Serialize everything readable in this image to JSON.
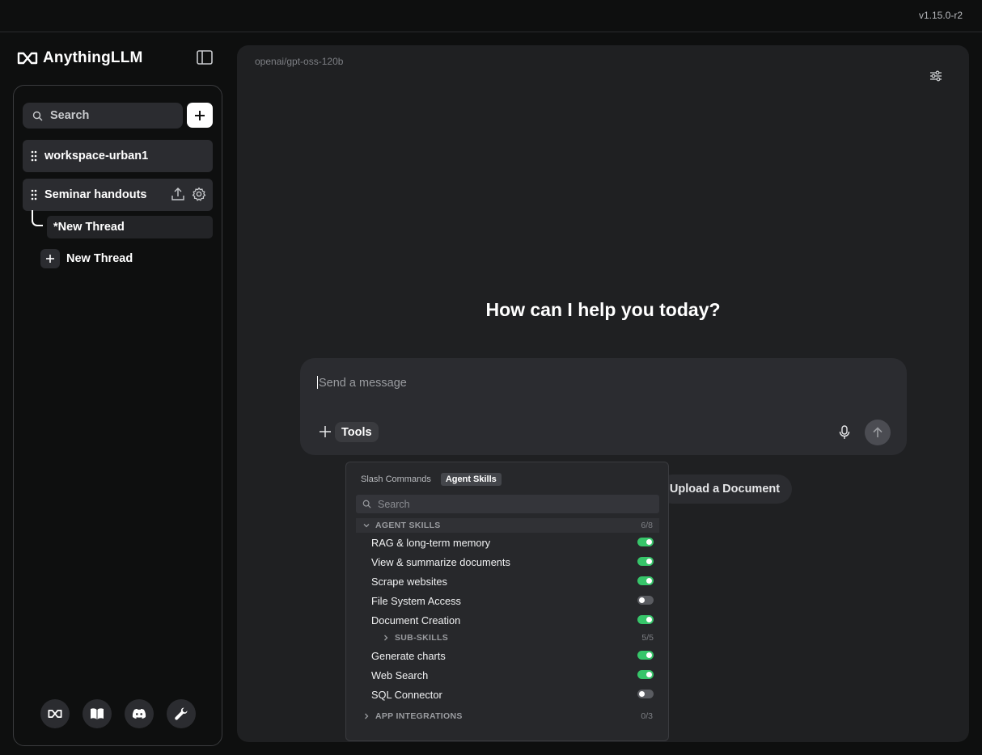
{
  "version": "v1.15.0-r2",
  "brand": {
    "name": "AnythingLLM"
  },
  "sidebar": {
    "search_placeholder": "Search",
    "workspaces": [
      {
        "label": "workspace-urban1"
      },
      {
        "label": "Seminar handouts"
      }
    ],
    "thread": {
      "label": "*New Thread"
    },
    "new_thread_label": "New Thread",
    "footer_icons": [
      "anythingllm-logo-icon",
      "book-icon",
      "discord-icon",
      "wrench-icon"
    ]
  },
  "main": {
    "model": "openai/gpt-oss-120b",
    "greeting": "How can I help you today?",
    "composer": {
      "placeholder": "Send a message",
      "tools_label": "Tools"
    },
    "upload_label": "Upload a Document"
  },
  "popup": {
    "tabs": [
      {
        "label": "Slash Commands",
        "active": false
      },
      {
        "label": "Agent Skills",
        "active": true
      }
    ],
    "search_placeholder": "Search",
    "agent_skills": {
      "title": "AGENT SKILLS",
      "count": "6/8",
      "items": [
        {
          "label": "RAG & long-term memory",
          "enabled": true
        },
        {
          "label": "View & summarize documents",
          "enabled": true
        },
        {
          "label": "Scrape websites",
          "enabled": true
        },
        {
          "label": "File System Access",
          "enabled": false
        },
        {
          "label": "Document Creation",
          "enabled": true
        }
      ],
      "sub_skills": {
        "title": "SUB-SKILLS",
        "count": "5/5"
      },
      "items_after": [
        {
          "label": "Generate charts",
          "enabled": true
        },
        {
          "label": "Web Search",
          "enabled": true
        },
        {
          "label": "SQL Connector",
          "enabled": false
        }
      ]
    },
    "app_integrations": {
      "title": "APP INTEGRATIONS",
      "count": "0/3"
    }
  },
  "colors": {
    "toggle_on": "#37c56a",
    "toggle_off": "#5a5c61",
    "panel": "#1f2022",
    "background": "#0e0f0f"
  }
}
